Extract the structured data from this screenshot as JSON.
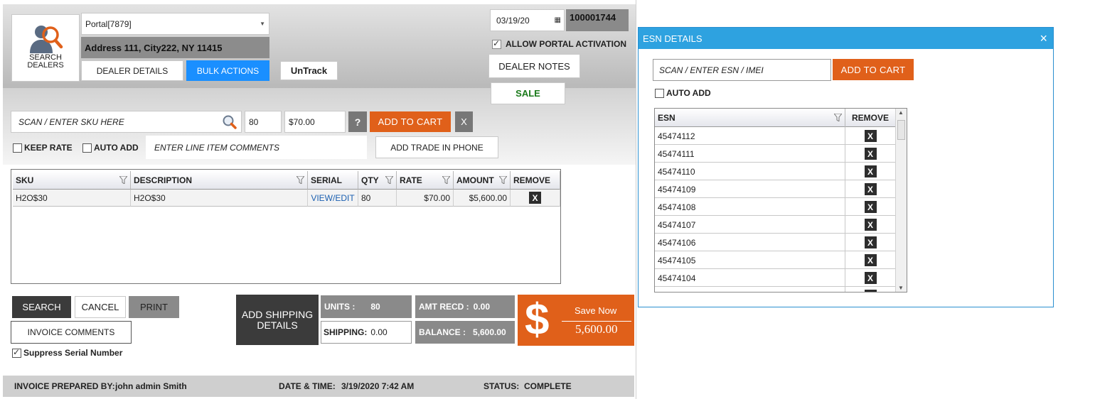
{
  "dealer": {
    "search_label_line1": "SEARCH",
    "search_label_line2": "DEALERS",
    "portal_select": "Portal[7879]",
    "address": "Address 111, City222, NY 11415",
    "dealer_details_tab": "DEALER DETAILS",
    "bulk_actions_tab": "BULK ACTIONS",
    "untrack_button": "UnTrack"
  },
  "header_right": {
    "date": "03/19/20",
    "invoice_number": "100001744",
    "allow_portal_activation": "ALLOW PORTAL ACTIVATION",
    "dealer_notes": "DEALER NOTES",
    "sale": "SALE"
  },
  "entry": {
    "sku_placeholder": "SCAN / ENTER SKU HERE",
    "qty": "80",
    "rate": "$70.00",
    "help": "?",
    "add_to_cart": "ADD TO CART",
    "clear": "X",
    "keep_rate": "KEEP RATE",
    "auto_add": "AUTO ADD",
    "comments_placeholder": "ENTER LINE ITEM COMMENTS",
    "add_trade_in": "ADD TRADE IN PHONE"
  },
  "grid": {
    "headers": {
      "sku": "SKU",
      "description": "DESCRIPTION",
      "serial": "SERIAL",
      "qty": "QTY",
      "rate": "RATE",
      "amount": "AMOUNT",
      "remove": "REMOVE"
    },
    "rows": [
      {
        "sku": "H2O$30",
        "description": "H2O$30",
        "serial": "VIEW/EDIT",
        "qty": "80",
        "rate": "$70.00",
        "amount": "$5,600.00",
        "remove": "X"
      }
    ]
  },
  "actions": {
    "search": "SEARCH",
    "cancel": "CANCEL",
    "print": "PRINT",
    "invoice_comments": "INVOICE COMMENTS",
    "suppress_serial": "Suppress Serial Number"
  },
  "summary": {
    "add_shipping_line1": "ADD SHIPPING",
    "add_shipping_line2": "DETAILS",
    "units_label": "UNITS :",
    "units_value": "80",
    "shipping_label": "SHIPPING:",
    "shipping_value": "0.00",
    "amt_recd_label": "AMT RECD :",
    "amt_recd_value": "0.00",
    "balance_label": "BALANCE :",
    "balance_value": "5,600.00",
    "dollar": "$",
    "save_now": "Save Now",
    "save_amount": "5,600.00"
  },
  "footer": {
    "prepared_by_label": "INVOICE PREPARED BY:",
    "prepared_by_value": "john  admin Smith",
    "datetime_label": "DATE & TIME:",
    "datetime_value": "3/19/2020 7:42 AM",
    "status_label": "STATUS:",
    "status_value": "COMPLETE"
  },
  "esn_dialog": {
    "title": "ESN DETAILS",
    "close": "×",
    "input_placeholder": "SCAN / ENTER ESN / IMEI",
    "add_to_cart": "ADD TO CART",
    "auto_add": "AUTO ADD",
    "col_esn": "ESN",
    "col_remove": "REMOVE",
    "rows": [
      "45474112",
      "45474111",
      "45474110",
      "45474109",
      "45474108",
      "45474107",
      "45474106",
      "45474105",
      "45474104",
      ""
    ]
  },
  "colors": {
    "accent_orange": "#e0601a",
    "bulk_blue": "#1a8fff",
    "dialog_blue": "#2ea2e0",
    "sale_green": "#1a7a1a"
  }
}
